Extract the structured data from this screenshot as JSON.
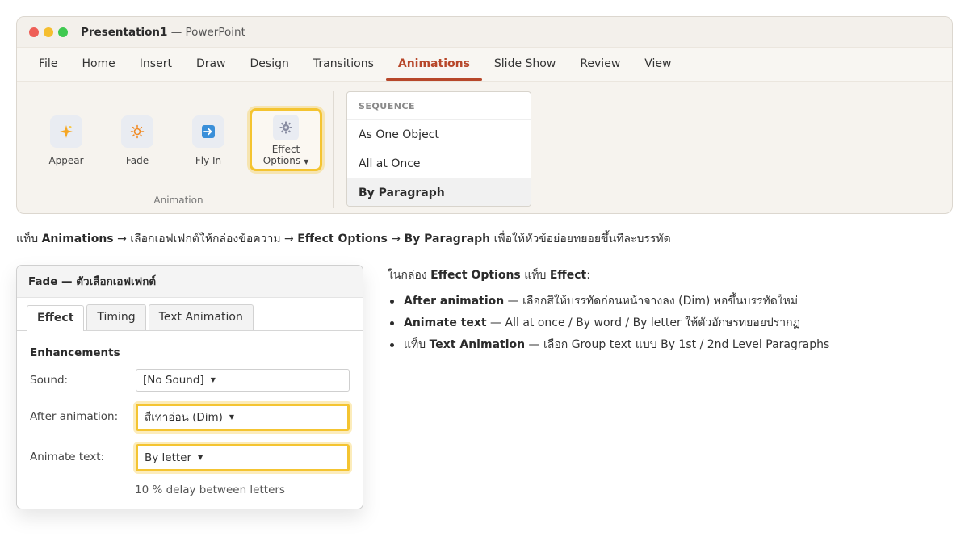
{
  "window": {
    "doc_name": "Presentation1",
    "app_suffix": " — PowerPoint"
  },
  "menu": {
    "tabs": [
      "File",
      "Home",
      "Insert",
      "Draw",
      "Design",
      "Transitions",
      "Animations",
      "Slide Show",
      "Review",
      "View"
    ],
    "active": "Animations"
  },
  "ribbon": {
    "buttons": [
      {
        "label": "Appear",
        "icon": "sparkle-icon"
      },
      {
        "label": "Fade",
        "icon": "sun-icon"
      },
      {
        "label": "Fly In",
        "icon": "arrow-right-icon"
      }
    ],
    "effect_options": {
      "line1": "Effect",
      "line2": "Options",
      "icon": "gear-icon"
    },
    "group_label": "Animation"
  },
  "sequence": {
    "header": "SEQUENCE",
    "items": [
      "As One Object",
      "All at Once",
      "By Paragraph"
    ],
    "selected": "By Paragraph"
  },
  "instruction": {
    "p1": "แท็บ ",
    "b1": "Animations",
    "p2": " → เลือกเอฟเฟกต์ให้กล่องข้อความ → ",
    "b2": "Effect Options",
    "p3": " → ",
    "b3": "By Paragraph",
    "p4": " เพื่อให้หัวข้อย่อยทยอยขึ้นทีละบรรทัด"
  },
  "dialog": {
    "title": "Fade — ตัวเลือกเอฟเฟกต์",
    "tabs": [
      "Effect",
      "Timing",
      "Text Animation"
    ],
    "active_tab": "Effect",
    "section": "Enhancements",
    "sound_label": "Sound:",
    "sound_value": "[No Sound]",
    "after_label": "After animation:",
    "after_value": "สีเทาอ่อน (Dim)",
    "animate_label": "Animate text:",
    "animate_value": "By letter",
    "delay_note": "10 % delay between letters"
  },
  "notes": {
    "intro_p1": "ในกล่อง ",
    "intro_b1": "Effect Options",
    "intro_p2": " แท็บ ",
    "intro_b2": "Effect",
    "intro_p3": ":",
    "items": [
      {
        "prefix": "",
        "bold": "After animation",
        "rest": " — เลือกสีให้บรรทัดก่อนหน้าจางลง (Dim) พอขึ้นบรรทัดใหม่"
      },
      {
        "prefix": "",
        "bold": "Animate text",
        "rest": " — All at once / By word / By letter ให้ตัวอักษรทยอยปรากฏ"
      },
      {
        "prefix": "แท็บ ",
        "bold": "Text Animation",
        "rest": " — เลือก Group text แบบ By 1st / 2nd Level Paragraphs"
      }
    ]
  },
  "colors": {
    "accent": "#b7472a",
    "highlight": "#f4c431"
  }
}
